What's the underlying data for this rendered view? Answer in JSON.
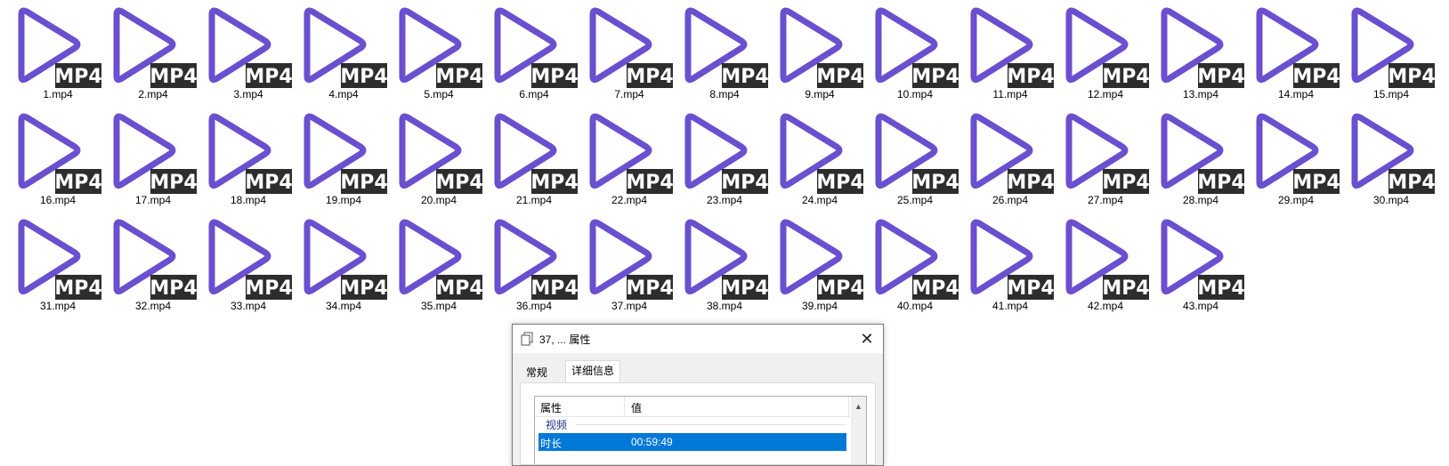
{
  "files": {
    "badge": "MP4",
    "items": [
      "1.mp4",
      "2.mp4",
      "3.mp4",
      "4.mp4",
      "5.mp4",
      "6.mp4",
      "7.mp4",
      "8.mp4",
      "9.mp4",
      "10.mp4",
      "11.mp4",
      "12.mp4",
      "13.mp4",
      "14.mp4",
      "15.mp4",
      "16.mp4",
      "17.mp4",
      "18.mp4",
      "19.mp4",
      "20.mp4",
      "21.mp4",
      "22.mp4",
      "23.mp4",
      "24.mp4",
      "25.mp4",
      "26.mp4",
      "27.mp4",
      "28.mp4",
      "29.mp4",
      "30.mp4",
      "31.mp4",
      "32.mp4",
      "33.mp4",
      "34.mp4",
      "35.mp4",
      "36.mp4",
      "37.mp4",
      "38.mp4",
      "39.mp4",
      "40.mp4",
      "41.mp4",
      "42.mp4",
      "43.mp4"
    ],
    "icon": "mp4-play-icon"
  },
  "colors": {
    "play_stroke": "#6a4fcf",
    "badge_bg": "#2d2d2d",
    "badge_text": "#ffffff",
    "selection": "#0078d7"
  },
  "dialog": {
    "title": "37, ... 属性",
    "close_glyph": "✕",
    "tabs": [
      {
        "label": "常规",
        "active": false
      },
      {
        "label": "详细信息",
        "active": true
      }
    ],
    "columns": {
      "property": "属性",
      "value": "值"
    },
    "group": "视频",
    "selected_row": {
      "property": "时长",
      "value": "00:59:49"
    },
    "scroll_up_glyph": "▲"
  }
}
